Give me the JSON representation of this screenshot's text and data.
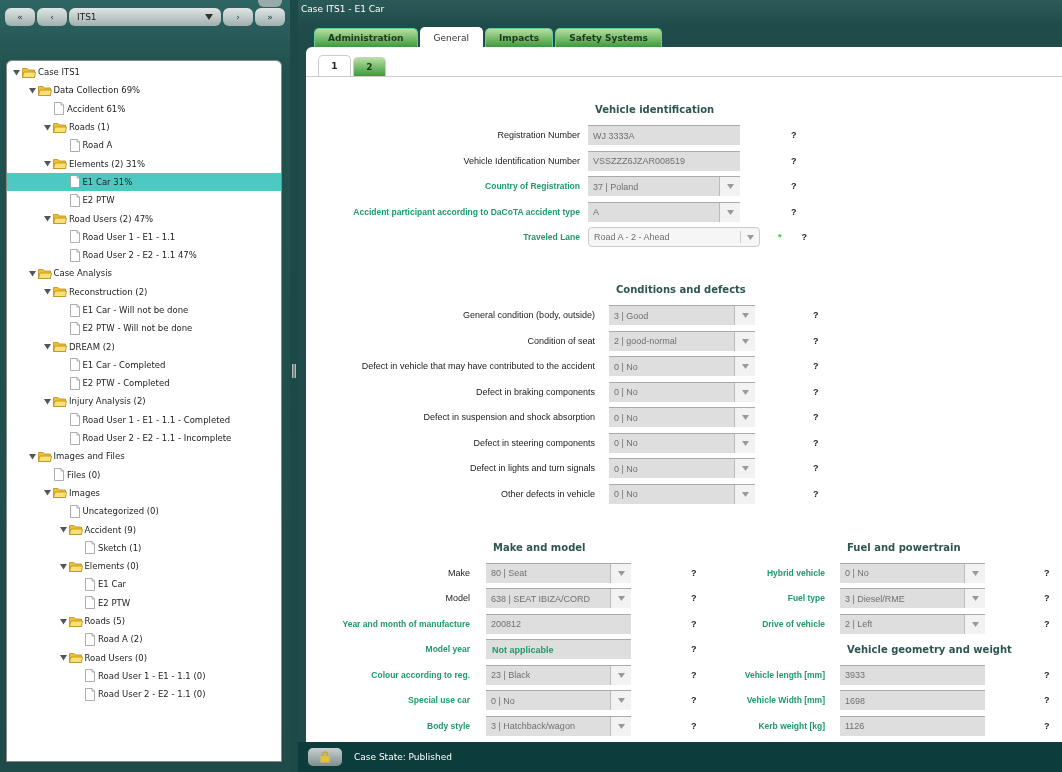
{
  "nav": {
    "first": "«",
    "prev": "‹",
    "case": "ITS1",
    "next": "›",
    "last": "»"
  },
  "tree": [
    {
      "label": "Case ITS1",
      "kind": "folder",
      "expanded": true,
      "selected": false,
      "children": [
        {
          "label": "Data Collection 69%",
          "kind": "folder",
          "expanded": true,
          "selected": false,
          "children": [
            {
              "label": "Accident 61%",
              "kind": "file",
              "selected": false
            },
            {
              "label": "Roads (1)",
              "kind": "folder",
              "expanded": true,
              "selected": false,
              "children": [
                {
                  "label": "Road A",
                  "kind": "file",
                  "selected": false
                }
              ]
            },
            {
              "label": "Elements (2) 31%",
              "kind": "folder",
              "expanded": true,
              "selected": false,
              "children": [
                {
                  "label": "E1 Car 31%",
                  "kind": "file",
                  "selected": true
                },
                {
                  "label": "E2 PTW",
                  "kind": "file",
                  "selected": false
                }
              ]
            },
            {
              "label": "Road Users (2) 47%",
              "kind": "folder",
              "expanded": true,
              "selected": false,
              "children": [
                {
                  "label": "Road User 1 - E1 - 1.1",
                  "kind": "file",
                  "selected": false
                },
                {
                  "label": "Road User 2 - E2 - 1.1 47%",
                  "kind": "file",
                  "selected": false
                }
              ]
            }
          ]
        },
        {
          "label": "Case Analysis",
          "kind": "folder",
          "expanded": true,
          "selected": false,
          "children": [
            {
              "label": "Reconstruction (2)",
              "kind": "folder",
              "expanded": true,
              "selected": false,
              "children": [
                {
                  "label": "E1 Car - Will not be done",
                  "kind": "file",
                  "selected": false
                },
                {
                  "label": "E2 PTW - Will not be done",
                  "kind": "file",
                  "selected": false
                }
              ]
            },
            {
              "label": "DREAM (2)",
              "kind": "folder",
              "expanded": true,
              "selected": false,
              "children": [
                {
                  "label": "E1 Car - Completed",
                  "kind": "file",
                  "selected": false
                },
                {
                  "label": "E2 PTW - Completed",
                  "kind": "file",
                  "selected": false
                }
              ]
            },
            {
              "label": "Injury Analysis (2)",
              "kind": "folder",
              "expanded": true,
              "selected": false,
              "children": [
                {
                  "label": "Road User 1 - E1 - 1.1 - Completed",
                  "kind": "file",
                  "selected": false
                },
                {
                  "label": "Road User 2 - E2 - 1.1 - Incomplete",
                  "kind": "file",
                  "selected": false
                }
              ]
            }
          ]
        },
        {
          "label": "Images and Files",
          "kind": "folder",
          "expanded": true,
          "selected": false,
          "children": [
            {
              "label": "Files (0)",
              "kind": "file",
              "selected": false
            },
            {
              "label": "Images",
              "kind": "folder",
              "expanded": true,
              "selected": false,
              "children": [
                {
                  "label": "Uncategorized (0)",
                  "kind": "file",
                  "selected": false
                },
                {
                  "label": "Accident (9)",
                  "kind": "folder",
                  "expanded": true,
                  "selected": false,
                  "children": [
                    {
                      "label": "Sketch (1)",
                      "kind": "file",
                      "selected": false
                    }
                  ]
                },
                {
                  "label": "Elements (0)",
                  "kind": "folder",
                  "expanded": true,
                  "selected": false,
                  "children": [
                    {
                      "label": "E1 Car",
                      "kind": "file",
                      "selected": false
                    },
                    {
                      "label": "E2 PTW",
                      "kind": "file",
                      "selected": false
                    }
                  ]
                },
                {
                  "label": "Roads (5)",
                  "kind": "folder",
                  "expanded": true,
                  "selected": false,
                  "children": [
                    {
                      "label": "Road A (2)",
                      "kind": "file",
                      "selected": false
                    }
                  ]
                },
                {
                  "label": "Road Users (0)",
                  "kind": "folder",
                  "expanded": true,
                  "selected": false,
                  "children": [
                    {
                      "label": "Road User 1 - E1 - 1.1 (0)",
                      "kind": "file",
                      "selected": false
                    },
                    {
                      "label": "Road User 2 - E2 - 1.1 (0)",
                      "kind": "file",
                      "selected": false
                    }
                  ]
                }
              ]
            }
          ]
        }
      ]
    }
  ],
  "window": {
    "title": "Case ITS1 - E1 Car"
  },
  "tabs": [
    {
      "label": "Administration",
      "selected": false
    },
    {
      "label": "General",
      "selected": true
    },
    {
      "label": "Impacts",
      "selected": false
    },
    {
      "label": "Safety Systems",
      "selected": false
    }
  ],
  "subtabs": [
    {
      "label": "1",
      "selected": true
    },
    {
      "label": "2",
      "selected": false
    }
  ],
  "sections": [
    {
      "title": "Vehicle identification",
      "fields": [
        {
          "label": "Registration Number",
          "kind": "text",
          "value": "WJ 3333A",
          "mandatory": false,
          "help": "?"
        },
        {
          "label": "Vehicle Identification Number",
          "kind": "text",
          "value": "VSSZZZ6JZAR008519",
          "mandatory": false,
          "help": "?"
        },
        {
          "label": "Country of Registration",
          "kind": "select",
          "value": "37 | Poland",
          "mandatory": true,
          "help": "?"
        },
        {
          "label": "Accident participant according to DaCoTA accident type",
          "kind": "select",
          "value": "A",
          "mandatory": true,
          "help": "?"
        },
        {
          "label": "Traveled Lane",
          "kind": "combo",
          "value": "Road A - 2 - Ahead",
          "mandatory": true,
          "required_mark": "*",
          "help": "?"
        }
      ]
    },
    {
      "title": "Conditions and defects",
      "fields": [
        {
          "label": "General condition (body, outside)",
          "kind": "select",
          "value": "3 | Good",
          "mandatory": false,
          "help": "?"
        },
        {
          "label": "Condition of seat",
          "kind": "select",
          "value": "2 | good-normal",
          "mandatory": false,
          "help": "?"
        },
        {
          "label": "Defect in vehicle that may have contributed to the accident",
          "kind": "select",
          "value": "0 | No",
          "mandatory": false,
          "help": "?"
        },
        {
          "label": "Defect in braking components",
          "kind": "select",
          "value": "0 | No",
          "mandatory": false,
          "help": "?"
        },
        {
          "label": "Defect in suspension and shock absorption",
          "kind": "select",
          "value": "0 | No",
          "mandatory": false,
          "help": "?"
        },
        {
          "label": "Defect in steering components",
          "kind": "select",
          "value": "0 | No",
          "mandatory": false,
          "help": "?"
        },
        {
          "label": "Defect in lights and turn signals",
          "kind": "select",
          "value": "0 | No",
          "mandatory": false,
          "help": "?"
        },
        {
          "label": "Other defects in vehicle",
          "kind": "select",
          "value": "0 | No",
          "mandatory": false,
          "help": "?"
        }
      ]
    },
    {
      "title": "Make and model",
      "fields": [
        {
          "label": "Make",
          "kind": "select",
          "value": "80 | Seat",
          "mandatory": false,
          "help": "?"
        },
        {
          "label": "Model",
          "kind": "select",
          "value": "638 | SEAT IBIZA/CORD",
          "mandatory": false,
          "help": "?"
        },
        {
          "label": "Year and month of manufacture",
          "kind": "text",
          "value": "200812",
          "mandatory": true,
          "help": "?"
        },
        {
          "label": "Model year",
          "kind": "note",
          "value": "Not applicable",
          "mandatory": true,
          "help": "?"
        },
        {
          "label": "Colour according to reg.",
          "kind": "select",
          "value": "23 | Black",
          "mandatory": true,
          "help": "?"
        },
        {
          "label": "Special use car",
          "kind": "select",
          "value": "0 | No",
          "mandatory": true,
          "help": "?"
        },
        {
          "label": "Body style",
          "kind": "select",
          "value": "3 | Hatchback/wagon",
          "mandatory": true,
          "help": "?"
        }
      ]
    },
    {
      "title": "Fuel and powertrain",
      "fields": [
        {
          "label": "Hybrid vehicle",
          "kind": "select",
          "value": "0 | No",
          "mandatory": true,
          "help": "?"
        },
        {
          "label": "Fuel type",
          "kind": "select",
          "value": "3 | Diesel/RME",
          "mandatory": true,
          "help": "?"
        },
        {
          "label": "Drive of vehicle",
          "kind": "select",
          "value": "2 | Left",
          "mandatory": true,
          "help": "?"
        }
      ]
    },
    {
      "title": "Vehicle geometry and weight",
      "fields": [
        {
          "label": "Vehicle length [mm]",
          "kind": "text",
          "value": "3933",
          "mandatory": true,
          "help": "?"
        },
        {
          "label": "Vehicle Width [mm]",
          "kind": "text",
          "value": "1698",
          "mandatory": true,
          "help": "?"
        },
        {
          "label": "Kerb weight [kg]",
          "kind": "text",
          "value": "1126",
          "mandatory": true,
          "help": "?"
        }
      ]
    }
  ],
  "status_bar": {
    "text": "Case State: Published"
  }
}
